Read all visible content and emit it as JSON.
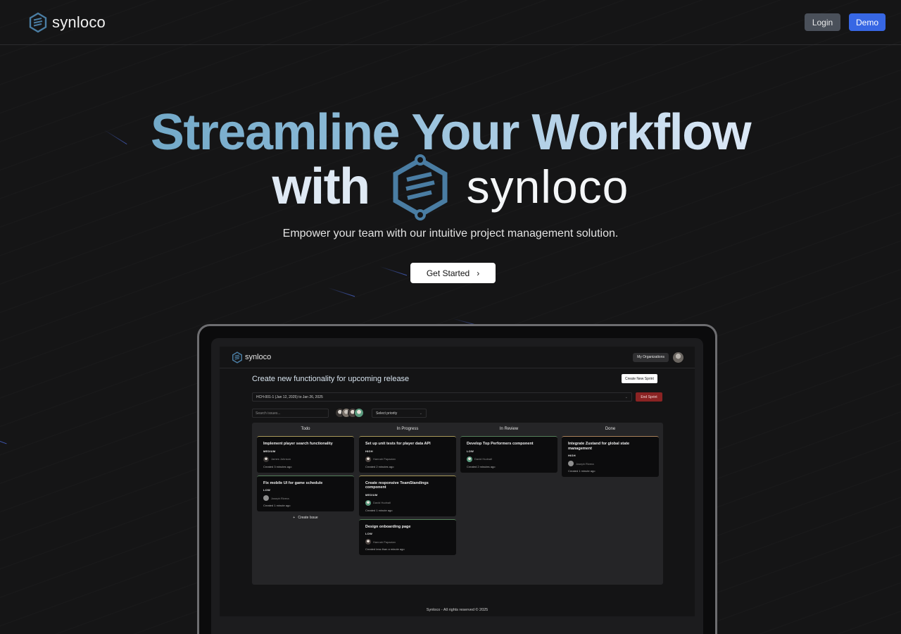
{
  "brand": {
    "name": "synloco",
    "accent": "#4a7da3"
  },
  "nav": {
    "login_label": "Login",
    "demo_label": "Demo"
  },
  "hero": {
    "title_line1": "Streamline Your Workflow",
    "title_line2": "with",
    "brand_name": "synloco",
    "subtitle": "Empower your team with our intuitive project management solution.",
    "cta_label": "Get Started",
    "cta_icon": "chevron-right-icon"
  },
  "app": {
    "brand_name": "synloco",
    "orgs_label": "My Organizations",
    "project_title": "Create new functionality for upcoming release",
    "create_sprint_label": "Create New Sprint",
    "sprint_value": "HCH-001-1 (Jan 12, 2025) to Jan 26, 2025",
    "end_sprint_label": "End Sprint",
    "search_placeholder": "Search issues...",
    "priority_placeholder": "Select priority",
    "columns": [
      {
        "title": "Todo",
        "cards": [
          {
            "title": "Implement player search functionality",
            "priority": "MEDIUM",
            "assignee": "James Johnson",
            "created": "Created 3 minutes ago",
            "accent": "#c8b86a"
          },
          {
            "title": "Fix mobile UI for game schedule",
            "priority": "LOW",
            "assignee": "Joseph Rivera",
            "created": "Created 1 minute ago",
            "accent": "#6a9a6a"
          }
        ],
        "create_label": "Create Issue"
      },
      {
        "title": "In Progress",
        "cards": [
          {
            "title": "Set up unit tests for player data API",
            "priority": "HIGH",
            "assignee": "Hannah Papazian",
            "created": "Created 2 minutes ago",
            "accent": "#c8b86a"
          },
          {
            "title": "Create responsive TeamStandings component",
            "priority": "MEDIUM",
            "assignee": "David Hudnall",
            "created": "Created 1 minute ago",
            "accent": "#c8b86a"
          },
          {
            "title": "Design onboarding page",
            "priority": "LOW",
            "assignee": "Hannah Papazian",
            "created": "Created less than a minute ago",
            "accent": "#6a9a6a"
          }
        ]
      },
      {
        "title": "In Review",
        "cards": [
          {
            "title": "Develop Top Performers component",
            "priority": "LOW",
            "assignee": "David Hudnall",
            "created": "Created 2 minutes ago",
            "accent": "#6a9a6a"
          }
        ]
      },
      {
        "title": "Done",
        "cards": [
          {
            "title": "Integrate Zustand for global state management",
            "priority": "HIGH",
            "assignee": "Joseph Rivera",
            "created": "Created 1 minute ago",
            "accent": "#c89a6a"
          }
        ]
      }
    ],
    "footer": "Synloco - All rights reserved © 2025"
  }
}
